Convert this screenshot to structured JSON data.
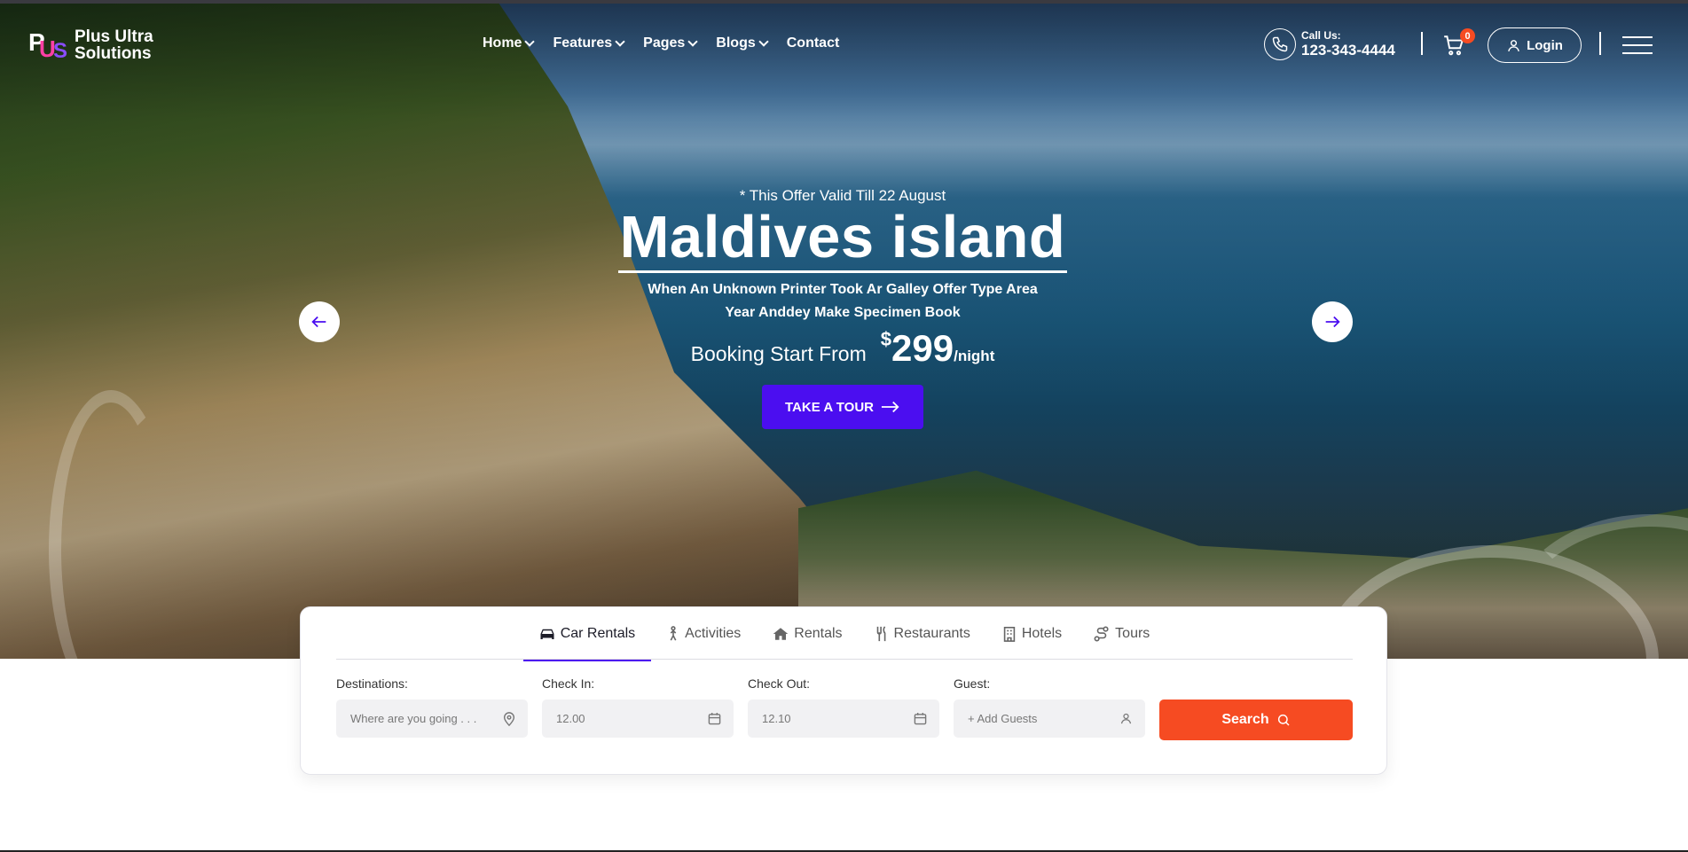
{
  "brand": {
    "line1": "Plus Ultra",
    "line2": "Solutions"
  },
  "nav": [
    {
      "label": "Home",
      "dropdown": true
    },
    {
      "label": "Features",
      "dropdown": true
    },
    {
      "label": "Pages",
      "dropdown": true
    },
    {
      "label": "Blogs",
      "dropdown": true
    },
    {
      "label": "Contact",
      "dropdown": false
    }
  ],
  "call": {
    "label": "Call Us:",
    "number": "123-343-4444"
  },
  "cart": {
    "count": "0"
  },
  "login": {
    "label": "Login"
  },
  "hero": {
    "offer": "* This Offer Valid Till 22 August",
    "title": "Maldives island",
    "desc_line1": "When An Unknown Printer Took Ar Galley Offer Type Area",
    "desc_line2": "Year Anddey Make Specimen Book",
    "booking_label": "Booking Start From",
    "currency": "$",
    "price": "299",
    "per": "/night",
    "cta": "TAKE A TOUR"
  },
  "tabs": [
    {
      "label": "Car Rentals",
      "icon": "car-icon",
      "active": true
    },
    {
      "label": "Activities",
      "icon": "hiking-icon",
      "active": false
    },
    {
      "label": "Rentals",
      "icon": "home-icon",
      "active": false
    },
    {
      "label": "Restaurants",
      "icon": "utensils-icon",
      "active": false
    },
    {
      "label": "Hotels",
      "icon": "building-icon",
      "active": false
    },
    {
      "label": "Tours",
      "icon": "route-icon",
      "active": false
    }
  ],
  "fields": {
    "destination": {
      "label": "Destinations:",
      "placeholder": "Where are you going . . ."
    },
    "checkin": {
      "label": "Check In:",
      "value": "12.00"
    },
    "checkout": {
      "label": "Check Out:",
      "value": "12.10"
    },
    "guest": {
      "label": "Guest:",
      "placeholder": "+ Add Guests"
    }
  },
  "search": {
    "label": "Search"
  },
  "colors": {
    "accent": "#4b0ef0",
    "search": "#f64b22",
    "badge": "#f64b22"
  }
}
